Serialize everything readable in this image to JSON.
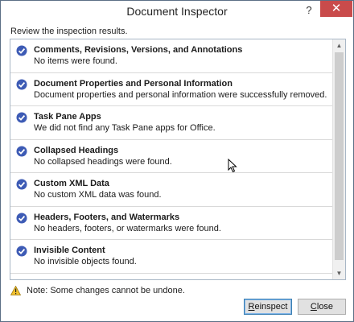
{
  "window": {
    "title": "Document Inspector",
    "help_glyph": "?",
    "close_glyph": "✕"
  },
  "subtitle": "Review the inspection results.",
  "results": [
    {
      "title": "Comments, Revisions, Versions, and Annotations",
      "description": "No items were found.",
      "status": "passed"
    },
    {
      "title": "Document Properties and Personal Information",
      "description": "Document properties and personal information were successfully removed.",
      "status": "passed"
    },
    {
      "title": "Task Pane Apps",
      "description": "We did not find any Task Pane apps for Office.",
      "status": "passed"
    },
    {
      "title": "Collapsed Headings",
      "description": "No collapsed headings were found.",
      "status": "passed"
    },
    {
      "title": "Custom XML Data",
      "description": "No custom XML data was found.",
      "status": "passed"
    },
    {
      "title": "Headers, Footers, and Watermarks",
      "description": "No headers, footers, or watermarks were found.",
      "status": "passed"
    },
    {
      "title": "Invisible Content",
      "description": "No invisible objects found.",
      "status": "passed"
    }
  ],
  "note": "Note: Some changes cannot be undone.",
  "buttons": {
    "reinspect_first": "R",
    "reinspect_rest": "einspect",
    "close_first": "C",
    "close_rest": "lose"
  },
  "colors": {
    "check_fill": "#3d5bb5",
    "close_button": "#c94b4b",
    "warning": "#f2c12e"
  },
  "icons": {
    "check": "check-circle-icon",
    "warning": "warning-triangle-icon",
    "cursor": "mouse-pointer-icon"
  }
}
